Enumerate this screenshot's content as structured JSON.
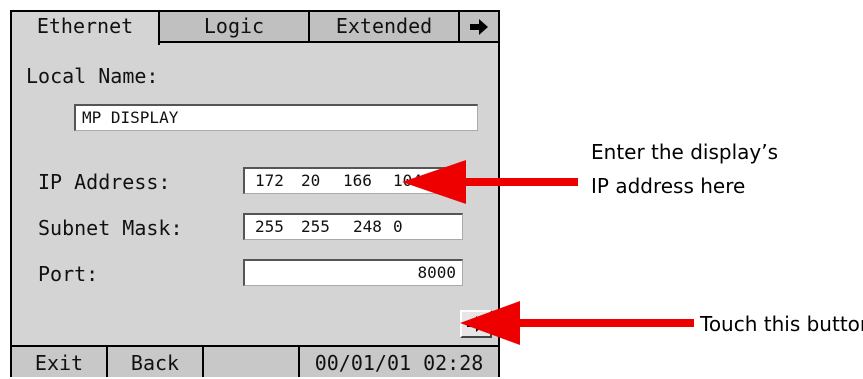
{
  "tabs": {
    "ethernet": "Ethernet",
    "logic": "Logic",
    "extended": "Extended",
    "next_icon": "right-arrow-icon"
  },
  "form": {
    "local_name_label": "Local Name:",
    "local_name_value": "MP DISPLAY",
    "ip_label": "IP Address:",
    "ip_octets": [
      "172",
      "20",
      "166",
      "104"
    ],
    "subnet_label": "Subnet Mask:",
    "subnet_octets": [
      "255",
      "255",
      "248",
      "0"
    ],
    "port_label": "Port:",
    "port_value": "8000"
  },
  "statusbar": {
    "exit": "Exit",
    "back": "Back",
    "datetime": "00/01/01 02:28"
  },
  "annotations": {
    "ip_note_line1": "Enter the display’s",
    "ip_note_line2": "IP address here",
    "button_note": "Touch this button"
  },
  "colors": {
    "arrow": "#ee0000",
    "panel": "#d4d4d4"
  }
}
